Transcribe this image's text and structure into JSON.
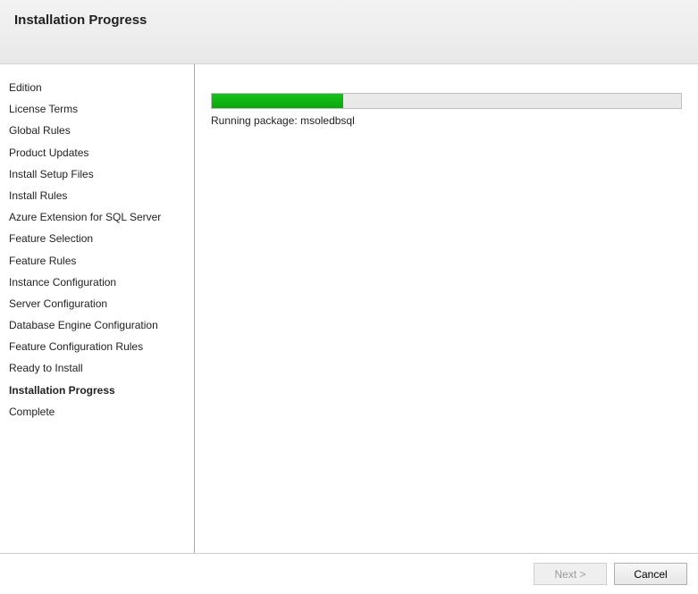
{
  "header": {
    "title": "Installation Progress"
  },
  "sidebar": {
    "items": [
      {
        "label": "Edition",
        "current": false
      },
      {
        "label": "License Terms",
        "current": false
      },
      {
        "label": "Global Rules",
        "current": false
      },
      {
        "label": "Product Updates",
        "current": false
      },
      {
        "label": "Install Setup Files",
        "current": false
      },
      {
        "label": "Install Rules",
        "current": false
      },
      {
        "label": "Azure Extension for SQL Server",
        "current": false
      },
      {
        "label": "Feature Selection",
        "current": false
      },
      {
        "label": "Feature Rules",
        "current": false
      },
      {
        "label": "Instance Configuration",
        "current": false
      },
      {
        "label": "Server Configuration",
        "current": false
      },
      {
        "label": "Database Engine Configuration",
        "current": false
      },
      {
        "label": "Feature Configuration Rules",
        "current": false
      },
      {
        "label": "Ready to Install",
        "current": false
      },
      {
        "label": "Installation Progress",
        "current": true
      },
      {
        "label": "Complete",
        "current": false
      }
    ]
  },
  "main": {
    "progress_percent": 28,
    "progress_color": "#0aa80d",
    "status_text": "Running package: msoledbsql"
  },
  "footer": {
    "next_label": "Next >",
    "next_enabled": false,
    "cancel_label": "Cancel",
    "cancel_enabled": true
  }
}
